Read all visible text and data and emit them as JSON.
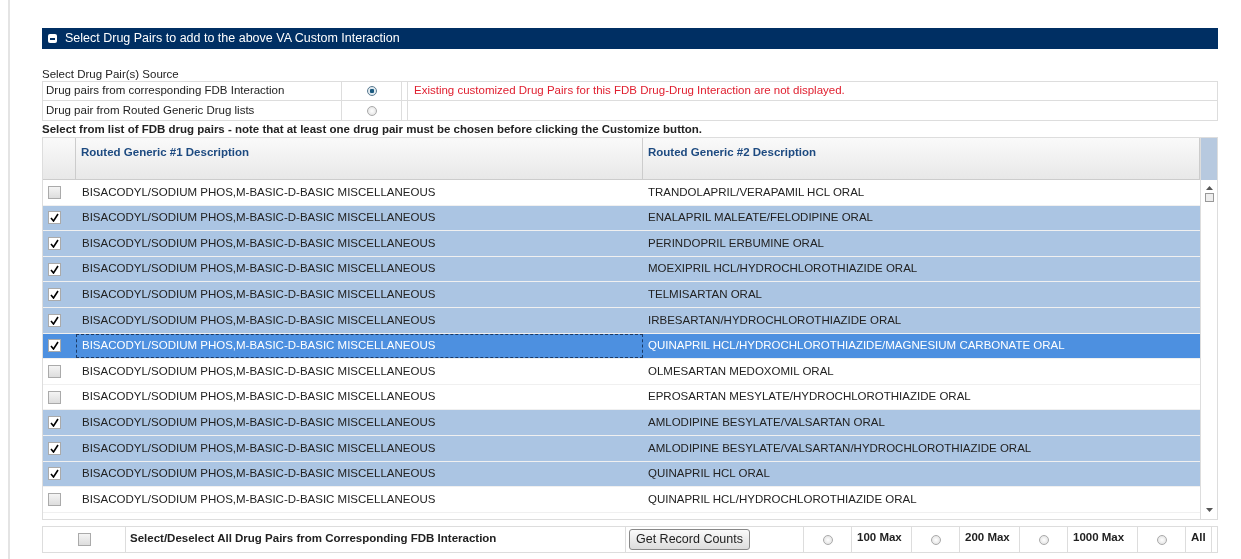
{
  "panel": {
    "title": "Select Drug Pairs to add to the above VA Custom Interaction",
    "expanded": true
  },
  "source": {
    "label": "Select Drug Pair(s) Source",
    "options": [
      {
        "label": "Drug pairs from corresponding FDB Interaction",
        "selected": true,
        "note": "Existing customized Drug Pairs for this FDB Drug-Drug Interaction are not displayed."
      },
      {
        "label": "Drug pair from Routed Generic Drug lists",
        "selected": false
      }
    ]
  },
  "instruction": "Select from list of FDB drug pairs - note that at least one drug pair must be chosen before clicking the Customize button.",
  "table": {
    "columns": [
      "Routed Generic #1 Description",
      "Routed Generic #2 Description"
    ],
    "rows": [
      {
        "drug_1": "BISACODYL/SODIUM PHOS,M-BASIC-D-BASIC MISCELLANEOUS",
        "drug_2": "TRANDOLAPRIL/VERAPAMIL HCL ORAL",
        "checked": false,
        "focused": false
      },
      {
        "drug_1": "BISACODYL/SODIUM PHOS,M-BASIC-D-BASIC MISCELLANEOUS",
        "drug_2": "ENALAPRIL MALEATE/FELODIPINE ORAL",
        "checked": true,
        "focused": false
      },
      {
        "drug_1": "BISACODYL/SODIUM PHOS,M-BASIC-D-BASIC MISCELLANEOUS",
        "drug_2": "PERINDOPRIL ERBUMINE ORAL",
        "checked": true,
        "focused": false
      },
      {
        "drug_1": "BISACODYL/SODIUM PHOS,M-BASIC-D-BASIC MISCELLANEOUS",
        "drug_2": "MOEXIPRIL HCL/HYDROCHLOROTHIAZIDE ORAL",
        "checked": true,
        "focused": false
      },
      {
        "drug_1": "BISACODYL/SODIUM PHOS,M-BASIC-D-BASIC MISCELLANEOUS",
        "drug_2": "TELMISARTAN ORAL",
        "checked": true,
        "focused": false
      },
      {
        "drug_1": "BISACODYL/SODIUM PHOS,M-BASIC-D-BASIC MISCELLANEOUS",
        "drug_2": "IRBESARTAN/HYDROCHLOROTHIAZIDE ORAL",
        "checked": true,
        "focused": false
      },
      {
        "drug_1": "BISACODYL/SODIUM PHOS,M-BASIC-D-BASIC MISCELLANEOUS",
        "drug_2": "QUINAPRIL HCL/HYDROCHLOROTHIAZIDE/MAGNESIUM CARBONATE ORAL",
        "checked": true,
        "focused": true
      },
      {
        "drug_1": "BISACODYL/SODIUM PHOS,M-BASIC-D-BASIC MISCELLANEOUS",
        "drug_2": "OLMESARTAN MEDOXOMIL ORAL",
        "checked": false,
        "focused": false
      },
      {
        "drug_1": "BISACODYL/SODIUM PHOS,M-BASIC-D-BASIC MISCELLANEOUS",
        "drug_2": "EPROSARTAN MESYLATE/HYDROCHLOROTHIAZIDE ORAL",
        "checked": false,
        "focused": false
      },
      {
        "drug_1": "BISACODYL/SODIUM PHOS,M-BASIC-D-BASIC MISCELLANEOUS",
        "drug_2": "AMLODIPINE BESYLATE/VALSARTAN ORAL",
        "checked": true,
        "focused": false
      },
      {
        "drug_1": "BISACODYL/SODIUM PHOS,M-BASIC-D-BASIC MISCELLANEOUS",
        "drug_2": "AMLODIPINE BESYLATE/VALSARTAN/HYDROCHLOROTHIAZIDE ORAL",
        "checked": true,
        "focused": false
      },
      {
        "drug_1": "BISACODYL/SODIUM PHOS,M-BASIC-D-BASIC MISCELLANEOUS",
        "drug_2": "QUINAPRIL HCL ORAL",
        "checked": true,
        "focused": false
      },
      {
        "drug_1": "BISACODYL/SODIUM PHOS,M-BASIC-D-BASIC MISCELLANEOUS",
        "drug_2": "QUINAPRIL HCL/HYDROCHLOROTHIAZIDE ORAL",
        "checked": false,
        "focused": false
      }
    ]
  },
  "footer": {
    "select_all": {
      "label": "Select/Deselect All Drug Pairs from Corresponding FDB Interaction",
      "checked": false
    },
    "button": "Get Record Counts",
    "limits": [
      {
        "label": "100 Max",
        "selected": false
      },
      {
        "label": "200 Max",
        "selected": false
      },
      {
        "label": "1000 Max",
        "selected": false
      },
      {
        "label": "All",
        "selected": false
      }
    ]
  }
}
